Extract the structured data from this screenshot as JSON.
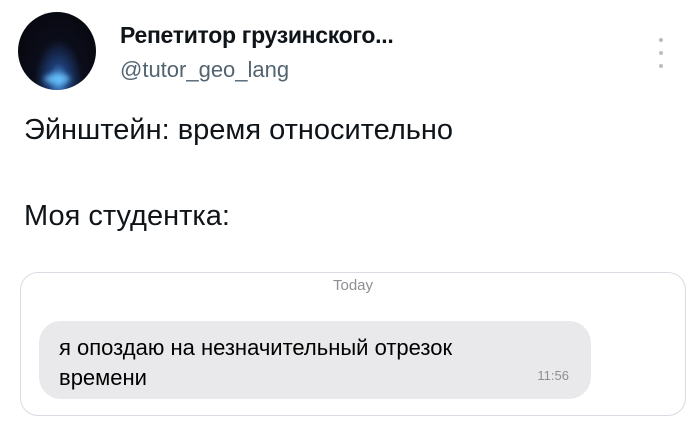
{
  "author": {
    "name": "Репетитор грузинского...",
    "handle": "@tutor_geo_lang",
    "avatar_icon": "profile-avatar"
  },
  "menu_icon": "more-vertical-icon",
  "tweet": {
    "line1": "Эйнштейн: время относительно",
    "line2": "Моя студентка:"
  },
  "chat": {
    "date_label": "Today",
    "message": {
      "text": "я опоздаю на незначительный отрезок времени",
      "time": "11:56"
    }
  },
  "colors": {
    "text": "#0f1419",
    "secondary_text": "#536471",
    "bubble": "#e9e9eb",
    "card_border": "#d7dde2"
  }
}
